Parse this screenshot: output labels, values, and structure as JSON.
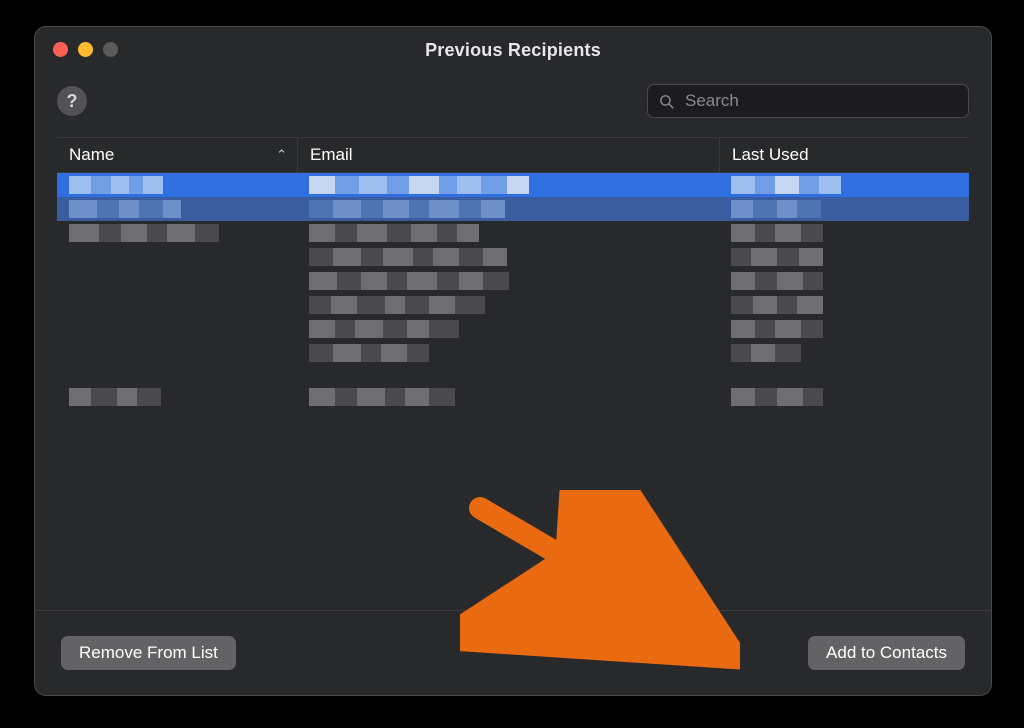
{
  "window": {
    "title": "Previous Recipients"
  },
  "toolbar": {
    "help_tooltip": "?",
    "search_placeholder": "Search",
    "search_value": ""
  },
  "table": {
    "columns": {
      "name": "Name",
      "email": "Email",
      "last_used": "Last Used"
    },
    "sort_column": "name",
    "sort_direction": "asc"
  },
  "footer": {
    "remove_label": "Remove From List",
    "add_label": "Add to Contacts"
  },
  "annotation": {
    "target": "add-to-contacts-button",
    "arrow_color": "#ea6a11"
  }
}
